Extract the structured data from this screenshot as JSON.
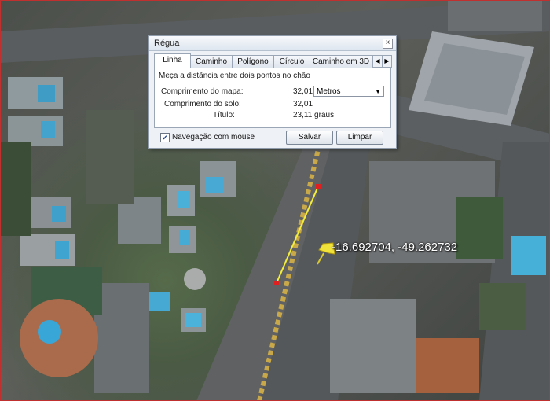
{
  "map": {
    "coordinates": "-16.692704, -49.262732",
    "pin_icon": "yellow-pushpin-icon",
    "ruler_line_color": "#f4ee3a",
    "ruler_endpoint_color": "#e02020"
  },
  "dialog": {
    "title": "Régua",
    "close_icon": "close-icon",
    "tabs": [
      {
        "label": "Linha"
      },
      {
        "label": "Caminho"
      },
      {
        "label": "Polígono"
      },
      {
        "label": "Círculo"
      },
      {
        "label": "Caminho em 3D"
      }
    ],
    "description": "Meça a distância entre dois pontos no chão",
    "map_length_label": "Comprimento do mapa:",
    "map_length_value": "32,01",
    "unit_select": "Metros",
    "ground_length_label": "Comprimento do solo:",
    "ground_length_value": "32,01",
    "heading_label": "Título:",
    "heading_value": "23,11 graus",
    "mouse_nav_label": "Navegação com mouse",
    "mouse_nav_checked": true,
    "save_button": "Salvar",
    "clear_button": "Limpar"
  }
}
